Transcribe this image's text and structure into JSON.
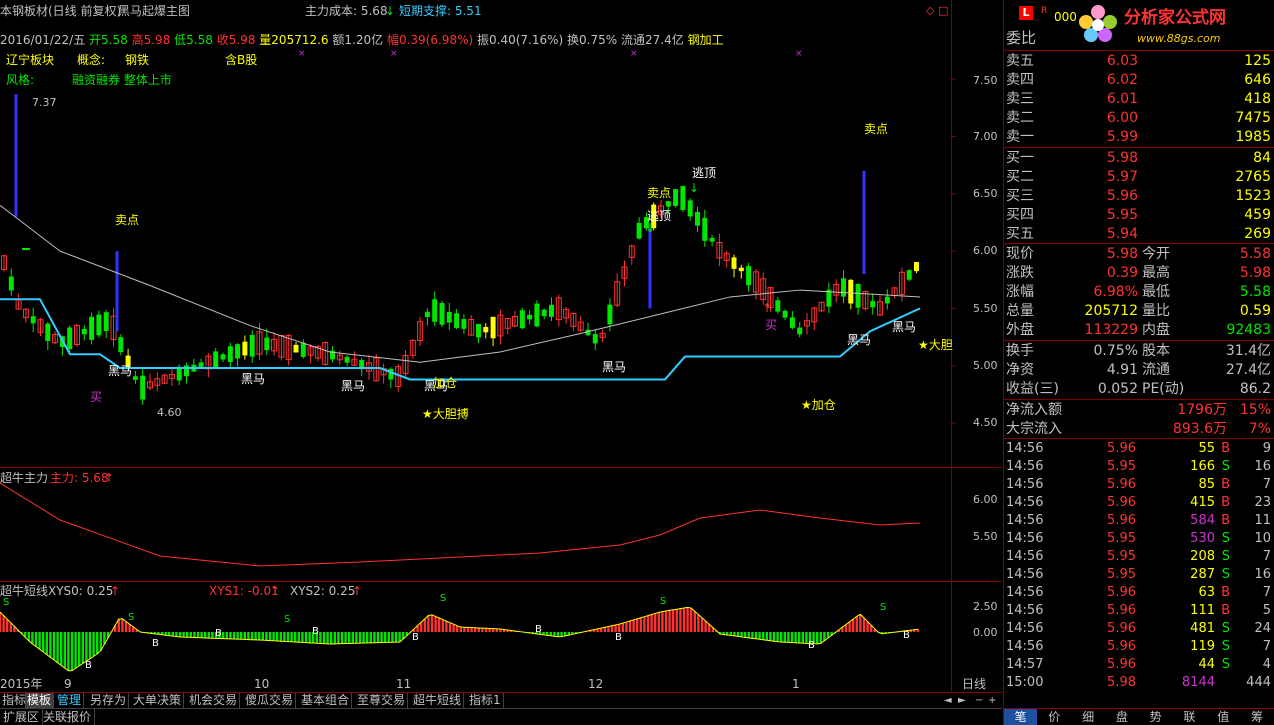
{
  "title": {
    "stock": "本钢板材(日线 前复权)",
    "indicator": "黑马起爆主图",
    "cost_label": "主力成本: 5.68",
    "support_label": "短期支撑: 5.51"
  },
  "quote_line": {
    "date": "2016/01/22/五",
    "open": "开5.58",
    "high": "高5.98",
    "low": "低5.58",
    "close": "收5.98",
    "volume": "量205712.6",
    "amount": "额1.20亿",
    "change": "幅0.39(6.98%)",
    "amplitude": "振0.40(7.16%)",
    "turnover": "换0.75%",
    "float": "流通27.4亿",
    "industry": "钢加工"
  },
  "info": {
    "sector_label": "辽宁板块",
    "concept_label": "概念:",
    "concept_value": "钢铁",
    "board": "含B股",
    "style_label": "风格:",
    "style_value": "融资融券 整体上市"
  },
  "price_axis": [
    "7.50",
    "7.00",
    "6.50",
    "6.00",
    "5.50",
    "5.00",
    "4.50"
  ],
  "main_annotations": {
    "high_label": "7.37",
    "low_label": "4.60",
    "sell": "卖点",
    "dark_horse": "黑马",
    "buy": "买",
    "escape_top": "逃顶",
    "add": "加仓",
    "brave": "★大胆搏",
    "add_star": "★加仓",
    "brave_edge": "★大胆"
  },
  "sub1": {
    "name": "超牛主力",
    "value": "主力: 5.68",
    "axis": [
      "6.00",
      "5.50"
    ]
  },
  "sub2": {
    "name": "超牛短线",
    "xys0": "XYS0: 0.25",
    "xys1": "XYS1: -0.01",
    "xys2": "XYS2: 0.25",
    "axis": [
      "2.50",
      "0.00"
    ]
  },
  "date_axis": {
    "year": "2015年",
    "months": [
      "9",
      "10",
      "11",
      "12",
      "1"
    ],
    "period": "日线"
  },
  "bottom_tabs": [
    "指标",
    "模板",
    "管理",
    "另存为",
    "大单决策",
    "机会交易",
    "傻瓜交易",
    "基本组合",
    "至尊交易",
    "超牛短线",
    "指标1"
  ],
  "bottom_row2": [
    "扩展区",
    "关联报价"
  ],
  "right_tabs": [
    "笔",
    "价",
    "细",
    "盘",
    "势",
    "联",
    "值",
    "筹"
  ],
  "logo": {
    "brand": "分析家公式网",
    "url": "www.88gs.com",
    "code_prefix": "000"
  },
  "order_book": {
    "ratio_label": "委比",
    "asks": [
      {
        "label": "卖五",
        "price": "6.03",
        "vol": "125"
      },
      {
        "label": "卖四",
        "price": "6.02",
        "vol": "646"
      },
      {
        "label": "卖三",
        "price": "6.01",
        "vol": "418"
      },
      {
        "label": "卖二",
        "price": "6.00",
        "vol": "7475"
      },
      {
        "label": "卖一",
        "price": "5.99",
        "vol": "1985"
      }
    ],
    "bids": [
      {
        "label": "买一",
        "price": "5.98",
        "vol": "84"
      },
      {
        "label": "买二",
        "price": "5.97",
        "vol": "2765"
      },
      {
        "label": "买三",
        "price": "5.96",
        "vol": "1523"
      },
      {
        "label": "买四",
        "price": "5.95",
        "vol": "459"
      },
      {
        "label": "买五",
        "price": "5.94",
        "vol": "269"
      }
    ]
  },
  "stats": [
    {
      "l1": "现价",
      "v1": "5.98",
      "l2": "今开",
      "v2": "5.58",
      "c1": "#ff3232",
      "c2": "#ff3232"
    },
    {
      "l1": "涨跌",
      "v1": "0.39",
      "l2": "最高",
      "v2": "5.98",
      "c1": "#ff3232",
      "c2": "#ff3232"
    },
    {
      "l1": "涨幅",
      "v1": "6.98%",
      "l2": "最低",
      "v2": "5.58",
      "c1": "#ff3232",
      "c2": "#00e600"
    },
    {
      "l1": "总量",
      "v1": "205712",
      "l2": "量比",
      "v2": "0.59",
      "c1": "#ffff00",
      "c2": "#ffff00"
    },
    {
      "l1": "外盘",
      "v1": "113229",
      "l2": "内盘",
      "v2": "92483",
      "c1": "#ff3232",
      "c2": "#00e600"
    }
  ],
  "stats2": [
    {
      "l1": "换手",
      "v1": "0.75%",
      "l2": "股本",
      "v2": "31.4亿"
    },
    {
      "l1": "净资",
      "v1": "4.91",
      "l2": "流通",
      "v2": "27.4亿"
    },
    {
      "l1": "收益(三)",
      "v1": "0.052",
      "l2": "PE(动)",
      "v2": "86.2"
    }
  ],
  "flows": [
    {
      "label": "净流入额",
      "value": "1796万",
      "pct": "15%"
    },
    {
      "label": "大宗流入",
      "value": "893.6万",
      "pct": "7%"
    }
  ],
  "ticks": [
    {
      "t": "14:56",
      "p": "5.96",
      "v": "55",
      "s": "B",
      "n": "9",
      "vc": "#ffff00"
    },
    {
      "t": "14:56",
      "p": "5.95",
      "v": "166",
      "s": "S",
      "n": "16",
      "vc": "#ffff00"
    },
    {
      "t": "14:56",
      "p": "5.96",
      "v": "85",
      "s": "B",
      "n": "7",
      "vc": "#ffff00"
    },
    {
      "t": "14:56",
      "p": "5.96",
      "v": "415",
      "s": "B",
      "n": "23",
      "vc": "#ffff00"
    },
    {
      "t": "14:56",
      "p": "5.96",
      "v": "584",
      "s": "B",
      "n": "11",
      "vc": "#cc33cc"
    },
    {
      "t": "14:56",
      "p": "5.95",
      "v": "530",
      "s": "S",
      "n": "10",
      "vc": "#cc33cc"
    },
    {
      "t": "14:56",
      "p": "5.95",
      "v": "208",
      "s": "S",
      "n": "7",
      "vc": "#ffff00"
    },
    {
      "t": "14:56",
      "p": "5.95",
      "v": "287",
      "s": "S",
      "n": "16",
      "vc": "#ffff00"
    },
    {
      "t": "14:56",
      "p": "5.96",
      "v": "63",
      "s": "B",
      "n": "7",
      "vc": "#ffff00"
    },
    {
      "t": "14:56",
      "p": "5.96",
      "v": "111",
      "s": "B",
      "n": "5",
      "vc": "#ffff00"
    },
    {
      "t": "14:56",
      "p": "5.96",
      "v": "481",
      "s": "S",
      "n": "24",
      "vc": "#ffff00"
    },
    {
      "t": "14:56",
      "p": "5.96",
      "v": "119",
      "s": "S",
      "n": "7",
      "vc": "#ffff00"
    },
    {
      "t": "14:57",
      "p": "5.96",
      "v": "44",
      "s": "S",
      "n": "4",
      "vc": "#ffff00"
    },
    {
      "t": "15:00",
      "p": "5.98",
      "v": "8144",
      "s": "",
      "n": "444",
      "vc": "#cc33cc"
    }
  ],
  "colors": {
    "up": "#ff3232",
    "down": "#00e600",
    "bg": "#000000",
    "grid": "#800000",
    "support": "#33ccff",
    "ma": "#c0c0c0",
    "yellow": "#ffff00"
  }
}
